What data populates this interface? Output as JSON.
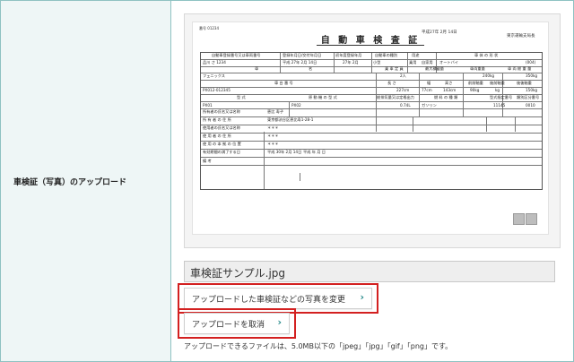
{
  "field_label": "車検証（写真）のアップロード",
  "preview": {
    "document": {
      "number": "番号 01234",
      "title": "自 動 車 検 査 証",
      "date": "平成27年 2月 14日",
      "issuer": "東京運輸支局長",
      "cells": [
        "自動車登録番号又は車両番号",
        "登録年月日/交付年月日",
        "初年度登録年月",
        "自動車の種別",
        "用途",
        "車 体 の 形 状",
        "品川 さ 1234",
        "平成 27年 2月 14日",
        "27年 2月",
        "小型",
        "乗用",
        "自家用",
        "オートバイ",
        "(004)",
        "車",
        "名",
        "乗 車 定 員",
        "最大積載量",
        "車両重量",
        "車 両 総 重 量",
        "フェニックス",
        "2人",
        "240kg",
        "350kg",
        "車 台 番 号",
        "長 さ",
        "幅",
        "高さ",
        "前前軸重",
        "後前軸重",
        "後後軸重",
        "PX012-012345",
        "227cm",
        "77cm",
        "143cm",
        "90kg",
        "kg",
        "150kg",
        "型 式",
        "原 動 機 の 型 式",
        "総排気量又は定格出力",
        "燃 料 の 種 類",
        "型式指定番号",
        "類別区分番号",
        "PX01",
        "PX02",
        "0.74L",
        "ガソリン",
        "11145",
        "0010",
        "所有者の氏名又は名称",
        "恵比 寿子",
        "所 有 者 の 住 所",
        "東京都渋谷区恵比寿1-28-1",
        "使用者の氏名又は名称",
        "＊＊＊",
        "使 用 者 の 住 所",
        "＊＊＊",
        "使 用 の 本 拠 の 位 置",
        "＊＊＊",
        "有効期間の満了する日",
        "平成 30年 2月 14日",
        "平成 年 月 日",
        "備 考"
      ]
    }
  },
  "file_name": "車検証サンプル.jpg",
  "buttons": {
    "change": "アップロードした車検証などの写真を変更",
    "cancel": "アップロードを取消",
    "chevron": "›"
  },
  "note": "アップロードできるファイルは、5.0MB以下の「jpeg」「jpg」「gif」「png」です。",
  "colors": {
    "border": "#8fc2c2",
    "label_bg": "#eef6f6",
    "accent": "#2a8c8c",
    "highlight": "#d32020"
  }
}
